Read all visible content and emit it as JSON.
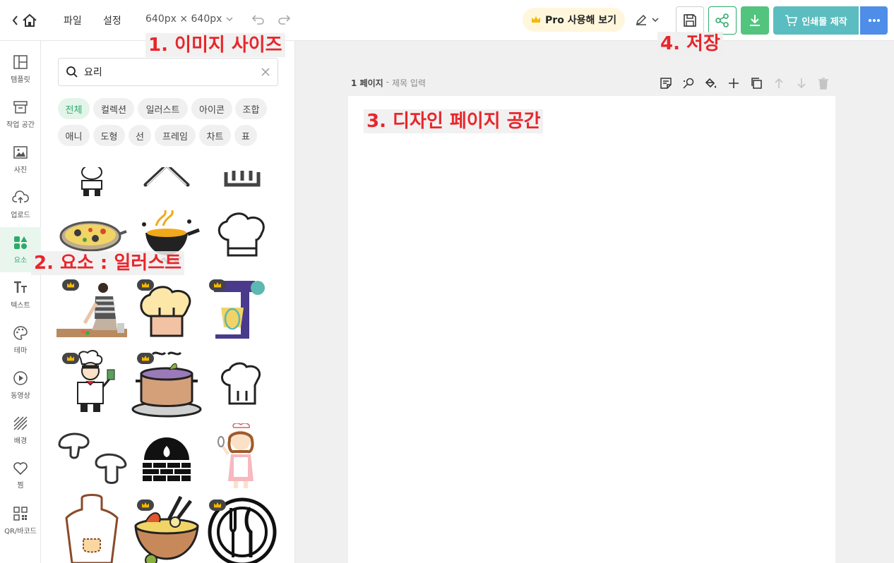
{
  "topbar": {
    "menu_file": "파일",
    "menu_settings": "설정",
    "size_label": "640px × 640px",
    "pro_label": "Pro 사용해 보기",
    "print_label": "인쇄물 제작"
  },
  "sidebar": {
    "items": [
      {
        "label": "템플릿",
        "icon": "layout-icon"
      },
      {
        "label": "작업 공간",
        "icon": "archive-box-icon"
      },
      {
        "label": "사진",
        "icon": "image-icon"
      },
      {
        "label": "업로드",
        "icon": "cloud-upload-icon"
      },
      {
        "label": "요소",
        "icon": "shapes-icon"
      },
      {
        "label": "텍스트",
        "icon": "text-icon"
      },
      {
        "label": "테마",
        "icon": "palette-icon"
      },
      {
        "label": "동영상",
        "icon": "play-circle-icon"
      },
      {
        "label": "배경",
        "icon": "background-stripes-icon"
      },
      {
        "label": "찜",
        "icon": "heart-icon"
      },
      {
        "label": "QR/바코드",
        "icon": "qr-code-icon"
      }
    ],
    "active_index": 4
  },
  "panel": {
    "search_value": "요리",
    "chips": [
      "전체",
      "컬렉션",
      "일러스트",
      "아이콘",
      "조합",
      "애니",
      "도형",
      "선",
      "프레임",
      "차트",
      "표"
    ],
    "active_chip": "전체"
  },
  "page": {
    "number_label": "1 페이지",
    "separator": "-",
    "title_placeholder": "제목 입력"
  },
  "annotations": {
    "a1": "1. 이미지 사이즈",
    "a2": "2. 요소 : 일러스트",
    "a3": "3. 디자인 페이지 공간",
    "a4": "4. 저장"
  },
  "colors": {
    "accent_green": "#2dab6a",
    "print_teal": "#5bbdbf",
    "more_blue": "#4f8ee8",
    "annotation_red": "#e8262b"
  }
}
